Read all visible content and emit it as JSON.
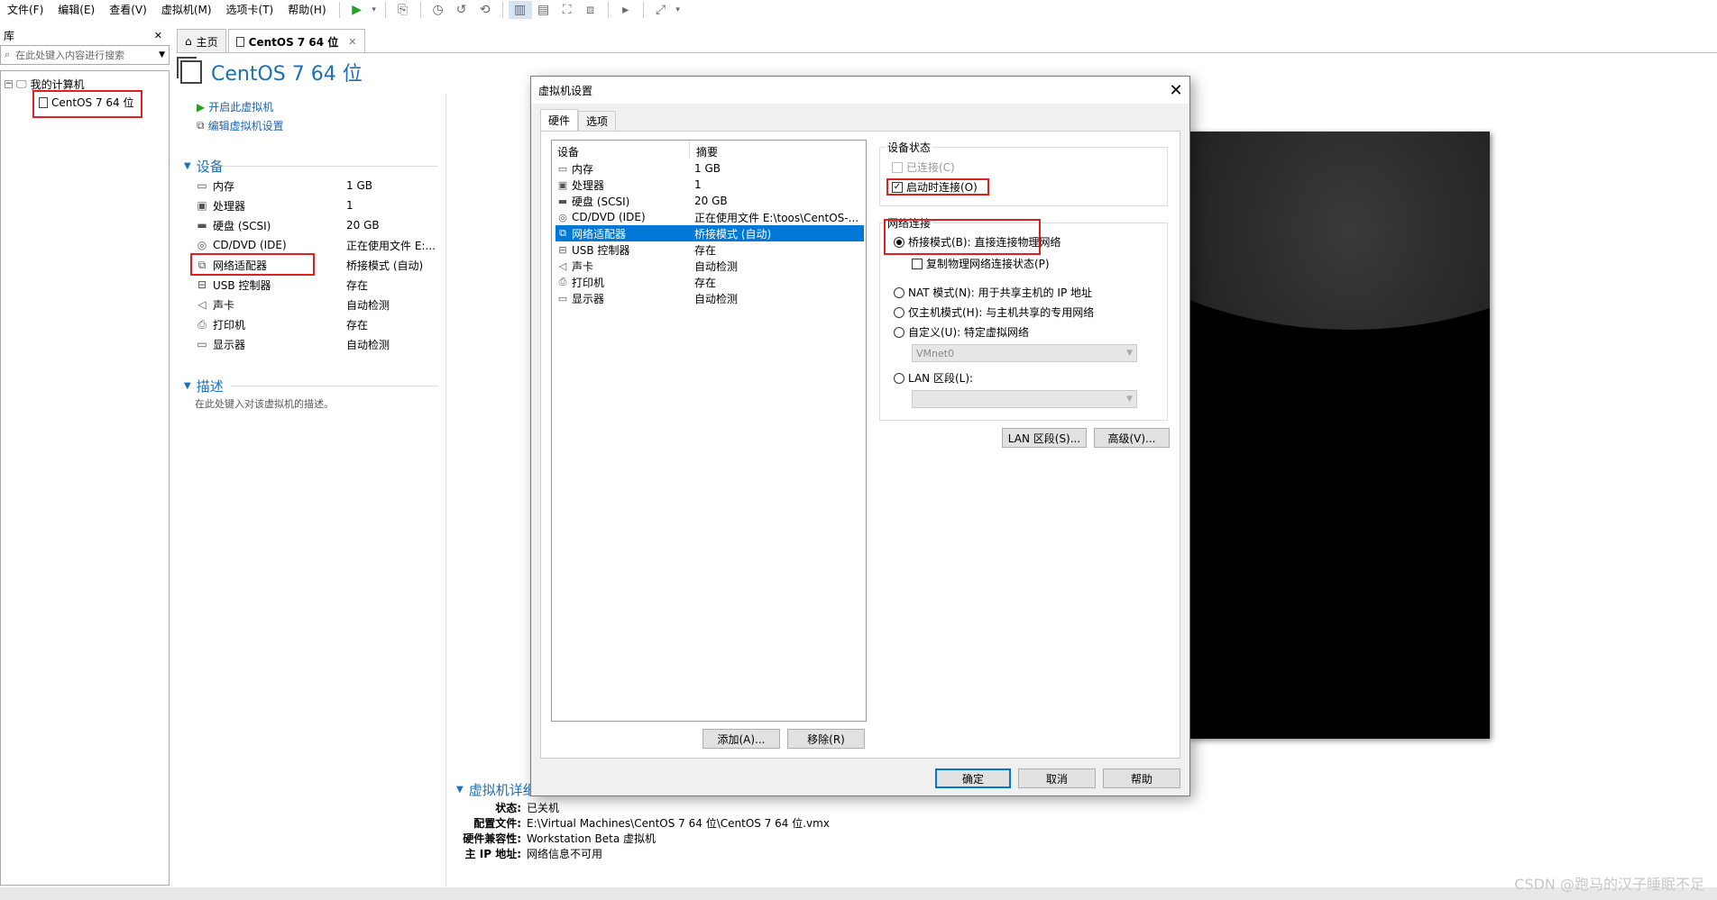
{
  "menubar": {
    "items": [
      "文件(F)",
      "编辑(E)",
      "查看(V)",
      "虚拟机(M)",
      "选项卡(T)",
      "帮助(H)"
    ]
  },
  "library": {
    "title": "库",
    "close": "✕",
    "search_placeholder": "在此处键入内容进行搜索",
    "tree_root": "我的计算机",
    "tree_vm": "CentOS 7 64 位"
  },
  "tabs": {
    "home": "主页",
    "vm": "CentOS 7 64 位",
    "close": "✕"
  },
  "vm_page": {
    "title": "CentOS 7 64 位",
    "action_start": "开启此虚拟机",
    "action_edit": "编辑虚拟机设置",
    "devices_title": "设备",
    "devices": [
      {
        "icon": "memory-icon",
        "glyph": "▭",
        "name": "内存",
        "value": "1 GB"
      },
      {
        "icon": "processor-icon",
        "glyph": "▣",
        "name": "处理器",
        "value": "1"
      },
      {
        "icon": "disk-icon",
        "glyph": "▬",
        "name": "硬盘 (SCSI)",
        "value": "20 GB"
      },
      {
        "icon": "cdrom-icon",
        "glyph": "◎",
        "name": "CD/DVD (IDE)",
        "value": "正在使用文件 E:..."
      },
      {
        "icon": "network-icon",
        "glyph": "⧉",
        "name": "网络适配器",
        "value": "桥接模式 (自动)"
      },
      {
        "icon": "usb-icon",
        "glyph": "⊟",
        "name": "USB 控制器",
        "value": "存在"
      },
      {
        "icon": "sound-icon",
        "glyph": "◁",
        "name": "声卡",
        "value": "自动检测"
      },
      {
        "icon": "printer-icon",
        "glyph": "⎙",
        "name": "打印机",
        "value": "存在"
      },
      {
        "icon": "display-icon",
        "glyph": "▭",
        "name": "显示器",
        "value": "自动检测"
      }
    ],
    "desc_title": "描述",
    "desc_placeholder": "在此处键入对该虚拟机的描述。"
  },
  "details": {
    "title": "虚拟机详细信息",
    "rows": [
      {
        "k": "状态:",
        "v": "已关机"
      },
      {
        "k": "配置文件:",
        "v": "E:\\Virtual Machines\\CentOS 7 64 位\\CentOS 7 64 位.vmx"
      },
      {
        "k": "硬件兼容性:",
        "v": "Workstation Beta 虚拟机"
      },
      {
        "k": "主 IP 地址:",
        "v": "网络信息不可用"
      }
    ]
  },
  "dialog": {
    "title": "虚拟机设置",
    "tabs": [
      "硬件",
      "选项"
    ],
    "list_head_device": "设备",
    "list_head_summary": "摘要",
    "list": [
      {
        "icon": "memory-icon",
        "glyph": "▭",
        "name": "内存",
        "value": "1 GB"
      },
      {
        "icon": "processor-icon",
        "glyph": "▣",
        "name": "处理器",
        "value": "1"
      },
      {
        "icon": "disk-icon",
        "glyph": "▬",
        "name": "硬盘 (SCSI)",
        "value": "20 GB"
      },
      {
        "icon": "cdrom-icon",
        "glyph": "◎",
        "name": "CD/DVD (IDE)",
        "value": "正在使用文件 E:\\toos\\CentOS-..."
      },
      {
        "icon": "network-icon",
        "glyph": "⧉",
        "name": "网络适配器",
        "value": "桥接模式 (自动)"
      },
      {
        "icon": "usb-icon",
        "glyph": "⊟",
        "name": "USB 控制器",
        "value": "存在"
      },
      {
        "icon": "sound-icon",
        "glyph": "◁",
        "name": "声卡",
        "value": "自动检测"
      },
      {
        "icon": "printer-icon",
        "glyph": "⎙",
        "name": "打印机",
        "value": "存在"
      },
      {
        "icon": "display-icon",
        "glyph": "▭",
        "name": "显示器",
        "value": "自动检测"
      }
    ],
    "selected_index": 4,
    "add_button": "添加(A)...",
    "remove_button": "移除(R)",
    "device_status_title": "设备状态",
    "connected_label": "已连接(C)",
    "connect_at_power_on_label": "启动时连接(O)",
    "network_title": "网络连接",
    "bridged_label": "桥接模式(B): 直接连接物理网络",
    "replicate_label": "复制物理网络连接状态(P)",
    "nat_label": "NAT 模式(N): 用于共享主机的 IP 地址",
    "hostonly_label": "仅主机模式(H): 与主机共享的专用网络",
    "custom_label": "自定义(U): 特定虚拟网络",
    "custom_value": "VMnet0",
    "lan_label": "LAN 区段(L):",
    "lan_segments_button": "LAN 区段(S)...",
    "advanced_button": "高级(V)...",
    "ok_button": "确定",
    "cancel_button": "取消",
    "help_button": "帮助"
  },
  "watermark": "CSDN @跑马的汉子睡眠不足"
}
